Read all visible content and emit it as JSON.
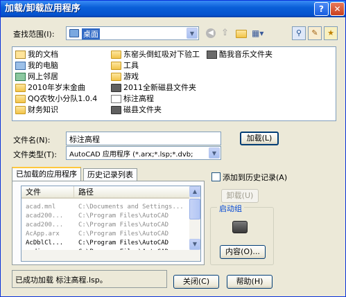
{
  "window": {
    "title": "加载/卸载应用程序",
    "help_label": "?",
    "close_label": "✕"
  },
  "look_in": {
    "label": "查找范围(I):",
    "value": "桌面"
  },
  "toolbar_icons": [
    "back-icon",
    "up-folder-icon",
    "new-folder-icon",
    "views-icon",
    "find-icon",
    "tools-icon",
    "favorites-icon"
  ],
  "files": [
    {
      "name": "我的文档",
      "icon": "docic"
    },
    {
      "name": "我的电脑",
      "icon": "pcic"
    },
    {
      "name": "网上邻居",
      "icon": "netic"
    },
    {
      "name": "2010年岁末金曲",
      "icon": "folder"
    },
    {
      "name": "QQ农牧小分队1.0.4",
      "icon": "folder"
    },
    {
      "name": "财务知识",
      "icon": "folder"
    },
    {
      "name": "东窑头倒虹吸对下验工",
      "icon": "folder"
    },
    {
      "name": "工具",
      "icon": "folder"
    },
    {
      "name": "游戏",
      "icon": "folder"
    },
    {
      "name": "2011全新磁县文件夹",
      "icon": "folder"
    },
    {
      "name": "标注高程",
      "icon": "fileic"
    },
    {
      "name": "磁县文件夹",
      "icon": "folder"
    },
    {
      "name": "酷我音乐文件夹",
      "icon": "musicic"
    }
  ],
  "filename": {
    "label": "文件名(N):",
    "value": "标注高程"
  },
  "filetype": {
    "label": "文件类型(T):",
    "value": "AutoCAD 应用程序 (*.arx;*.lsp;*.dvb;"
  },
  "load_button": "加载(L)",
  "tabs": [
    "已加载的应用程序",
    "历史记录列表"
  ],
  "table": {
    "headers": [
      "文件",
      "路径"
    ],
    "rows": [
      {
        "file": "acad.mnl",
        "path": "C:\\Documents and Settings...",
        "dim": true
      },
      {
        "file": "acad200...",
        "path": "C:\\Program Files\\AutoCAD",
        "dim": true
      },
      {
        "file": "acad200...",
        "path": "C:\\Program Files\\AutoCAD",
        "dim": true
      },
      {
        "file": "AcApp.arx",
        "path": "C:\\Program Files\\AutoCAD",
        "dim": true
      },
      {
        "file": "AcDblCl...",
        "path": "C:\\Program Files\\AutoCAD",
        "dim": false
      },
      {
        "file": "acdim.arx",
        "path": "C:\\Program Files\\AutoCAD",
        "dim": false
      }
    ]
  },
  "add_history": "添加到历史记录(A)",
  "unload_button": "卸载(U)",
  "startup_group": {
    "title": "启动组",
    "contents_button": "内容(O)..."
  },
  "status_text": "已成功加载 标注高程.lsp。",
  "close_button": "关闭(C)",
  "help_button": "帮助(H)"
}
